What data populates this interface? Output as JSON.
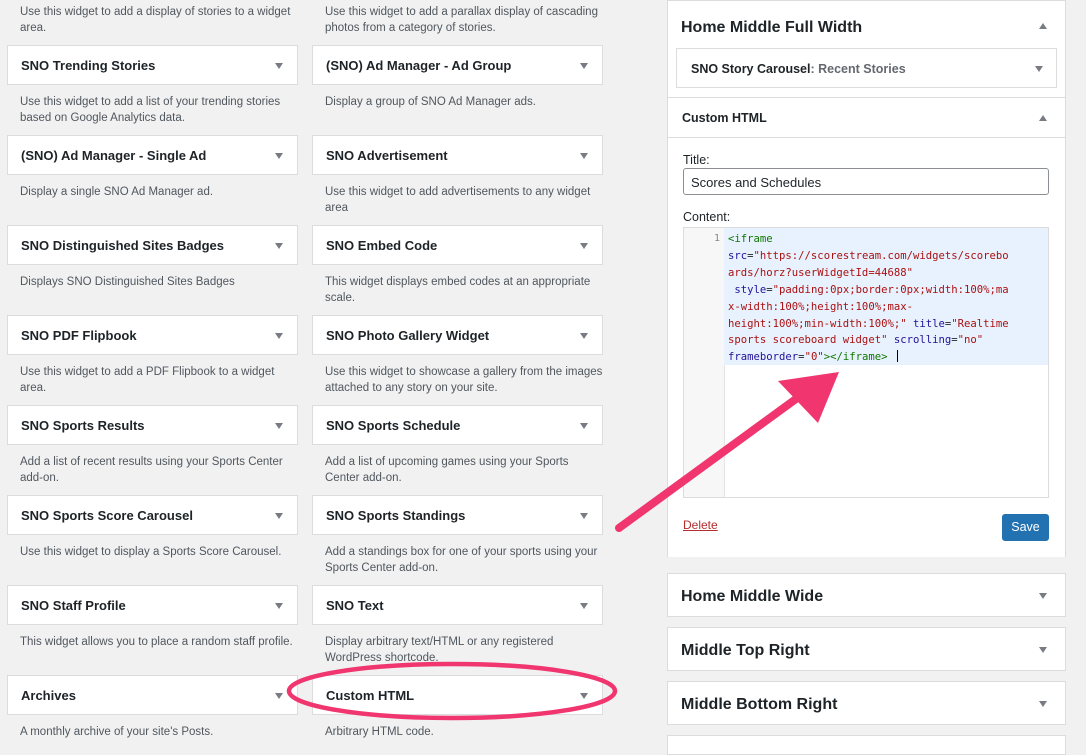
{
  "available_widgets": [
    {
      "title": "",
      "desc": "Use this widget to add a display of stories to a widget area."
    },
    {
      "title": "",
      "desc": "Use this widget to add a parallax display of cascading photos from a category of stories."
    },
    {
      "title": "SNO Trending Stories",
      "desc": "Use this widget to add a list of your trending stories based on Google Analytics data."
    },
    {
      "title": "(SNO) Ad Manager - Ad Group",
      "desc": "Display a group of SNO Ad Manager ads."
    },
    {
      "title": "(SNO) Ad Manager - Single Ad",
      "desc": "Display a single SNO Ad Manager ad."
    },
    {
      "title": "SNO Advertisement",
      "desc": "Use this widget to add advertisements to any widget area"
    },
    {
      "title": "SNO Distinguished Sites Badges",
      "desc": "Displays SNO Distinguished Sites Badges"
    },
    {
      "title": "SNO Embed Code",
      "desc": "This widget displays embed codes at an appropriate scale."
    },
    {
      "title": "SNO PDF Flipbook",
      "desc": "Use this widget to add a PDF Flipbook to a widget area."
    },
    {
      "title": "SNO Photo Gallery Widget",
      "desc": "Use this widget to showcase a gallery from the images attached to any story on your site."
    },
    {
      "title": "SNO Sports Results",
      "desc": "Add a list of recent results using your Sports Center add-on."
    },
    {
      "title": "SNO Sports Schedule",
      "desc": "Add a list of upcoming games using your Sports Center add-on."
    },
    {
      "title": "SNO Sports Score Carousel",
      "desc": "Use this widget to display a Sports Score Carousel."
    },
    {
      "title": "SNO Sports Standings",
      "desc": "Add a standings box for one of your sports using your Sports Center add-on."
    },
    {
      "title": "SNO Staff Profile",
      "desc": "This widget allows you to place a random staff profile."
    },
    {
      "title": "SNO Text",
      "desc": "Display arbitrary text/HTML or any registered WordPress shortcode."
    },
    {
      "title": "Archives",
      "desc": "A monthly archive of your site's Posts."
    },
    {
      "title": "Custom HTML",
      "desc": "Arbitrary HTML code."
    }
  ],
  "home_middle_full_width": {
    "title": "Home Middle Full Width",
    "carousel_widget": {
      "name": "SNO Story Carousel",
      "sub": ": Recent Stories"
    },
    "custom_html": {
      "header": "Custom HTML",
      "title_label": "Title:",
      "title_value": "Scores and Schedules",
      "content_label": "Content:",
      "line_number": "1",
      "delete_label": "Delete",
      "save_label": "Save"
    }
  },
  "other_areas": [
    {
      "title": "Home Middle Wide"
    },
    {
      "title": "Middle Top Right"
    },
    {
      "title": "Middle Bottom Right"
    }
  ],
  "colors": {
    "annotation": "#f0356f",
    "save_button": "#2271b1",
    "delete_link": "#b32d2e"
  }
}
